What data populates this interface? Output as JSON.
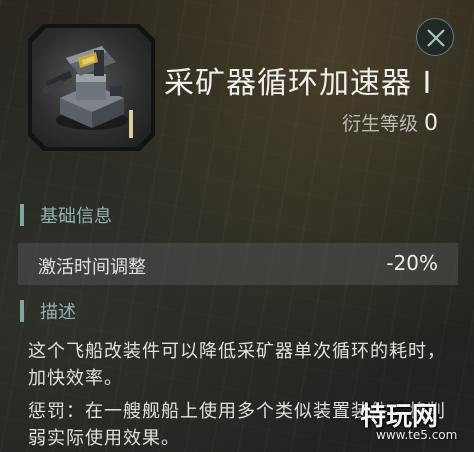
{
  "item": {
    "title": "采矿器循环加速器 I",
    "icon": "mining-turret-module-icon",
    "meta_level_label": "衍生等级",
    "meta_level_value": "0"
  },
  "close_button": {
    "icon": "close-icon"
  },
  "sections": {
    "basic_info": {
      "heading": "基础信息",
      "attributes": [
        {
          "name": "激活时间调整",
          "value": "-20%"
        }
      ]
    },
    "description": {
      "heading": "描述",
      "paragraphs": [
        "这个飞船改装件可以降低采矿器单次循环的耗时，加快效率。",
        "惩罚：在一艘舰船上使用多个类似装置装件，将削弱实际使用效果。"
      ]
    }
  },
  "watermark": {
    "text": "特玩网",
    "url": "www.te5.com"
  },
  "colors": {
    "accent": "#7ea79d",
    "section_label": "#93b3ad",
    "meta_bar": "#d8cf9a",
    "row_bg": "#4e5250"
  }
}
